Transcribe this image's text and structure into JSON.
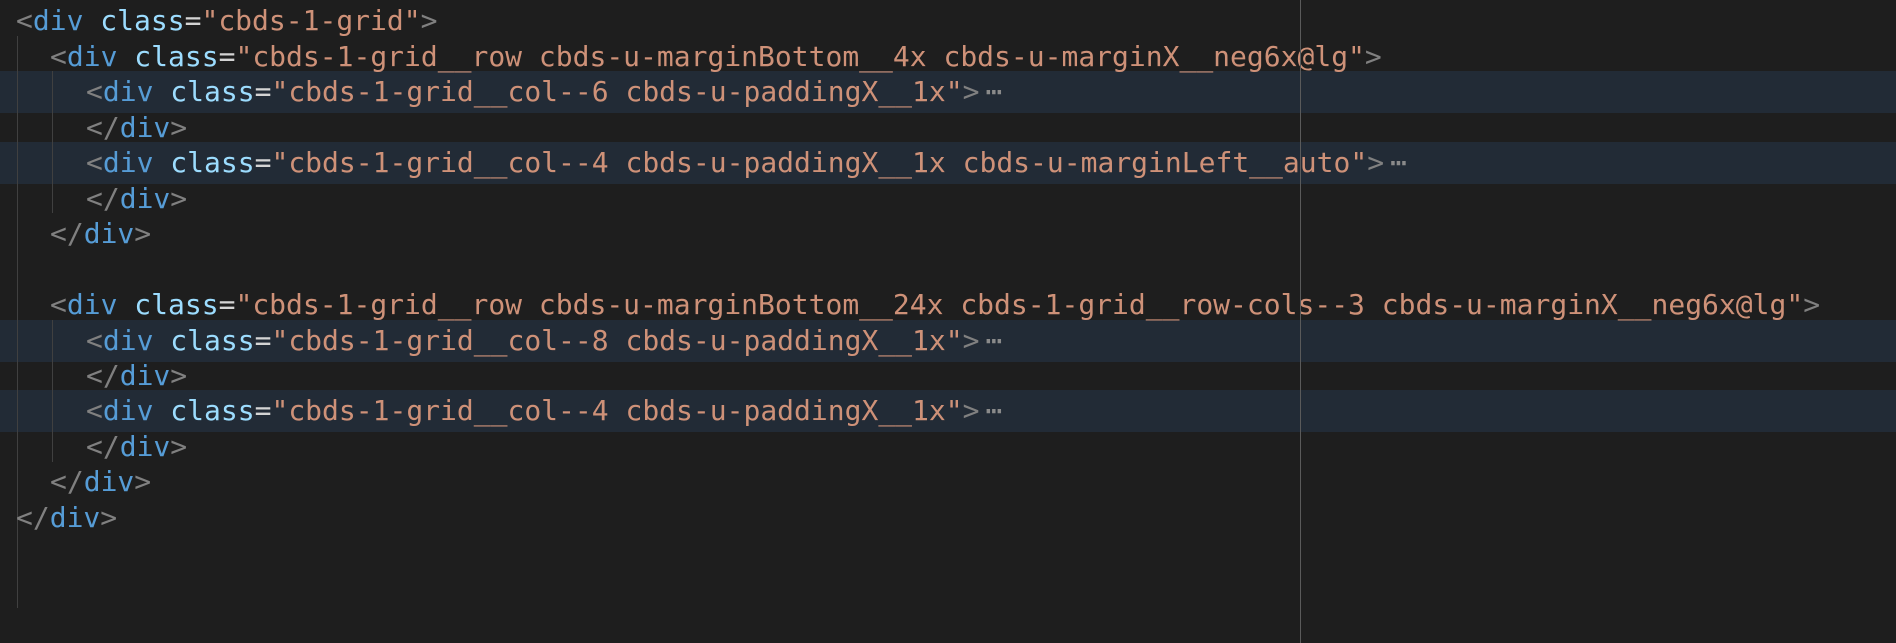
{
  "colors": {
    "background": "#1e1e1e",
    "line_highlight": "#222b36",
    "tag": "#569cd6",
    "attribute": "#9cdcfe",
    "string": "#ce9178",
    "bracket": "#808080",
    "fold_ellipsis": "#8a8a8a"
  },
  "code": {
    "tag_div": "div",
    "attr_class": "class",
    "equals": "=",
    "open_bracket": "<",
    "close_bracket": ">",
    "end_open_bracket": "</",
    "quote": "\"",
    "fold_ellipsis": "⋯",
    "lines": [
      {
        "value": "cbds-1-grid"
      },
      {
        "value": "cbds-1-grid__row cbds-u-marginBottom__4x cbds-u-marginX__neg6x@lg"
      },
      {
        "value": "cbds-1-grid__col--6 cbds-u-paddingX__1x"
      },
      {
        "value": ""
      },
      {
        "value": "cbds-1-grid__col--4 cbds-u-paddingX__1x cbds-u-marginLeft__auto"
      },
      {
        "value": ""
      },
      {
        "value": ""
      },
      {
        "value": ""
      },
      {
        "value": "cbds-1-grid__row cbds-u-marginBottom__24x cbds-1-grid__row-cols--3 cbds-u-marginX__neg6x@lg"
      },
      {
        "value": "cbds-1-grid__col--8 cbds-u-paddingX__1x"
      },
      {
        "value": ""
      },
      {
        "value": "cbds-1-grid__col--4 cbds-u-paddingX__1x"
      },
      {
        "value": ""
      },
      {
        "value": ""
      },
      {
        "value": ""
      }
    ]
  }
}
